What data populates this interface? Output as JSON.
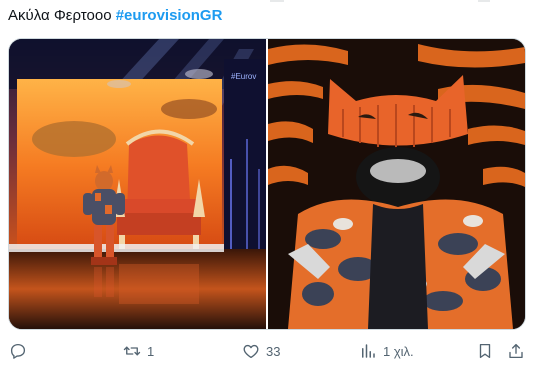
{
  "tweet": {
    "text_plain": "Ακύλα Φερτοοο",
    "hashtag": "#eurovisionGR"
  },
  "media": {
    "left_image_icon": "stage-performer-throne-image",
    "right_image_icon": "tiger-costume-closeup-image"
  },
  "actions": {
    "reply": {
      "icon": "reply-icon",
      "count": ""
    },
    "retweet": {
      "icon": "retweet-icon",
      "count": "1"
    },
    "like": {
      "icon": "heart-icon",
      "count": "33"
    },
    "views": {
      "icon": "views-icon",
      "count": "1 χιλ."
    },
    "bookmark": {
      "icon": "bookmark-icon"
    },
    "share": {
      "icon": "share-icon"
    }
  },
  "colors": {
    "hashtag": "#1d9bf0",
    "action_gray": "#536471",
    "border": "#cfd9de"
  }
}
